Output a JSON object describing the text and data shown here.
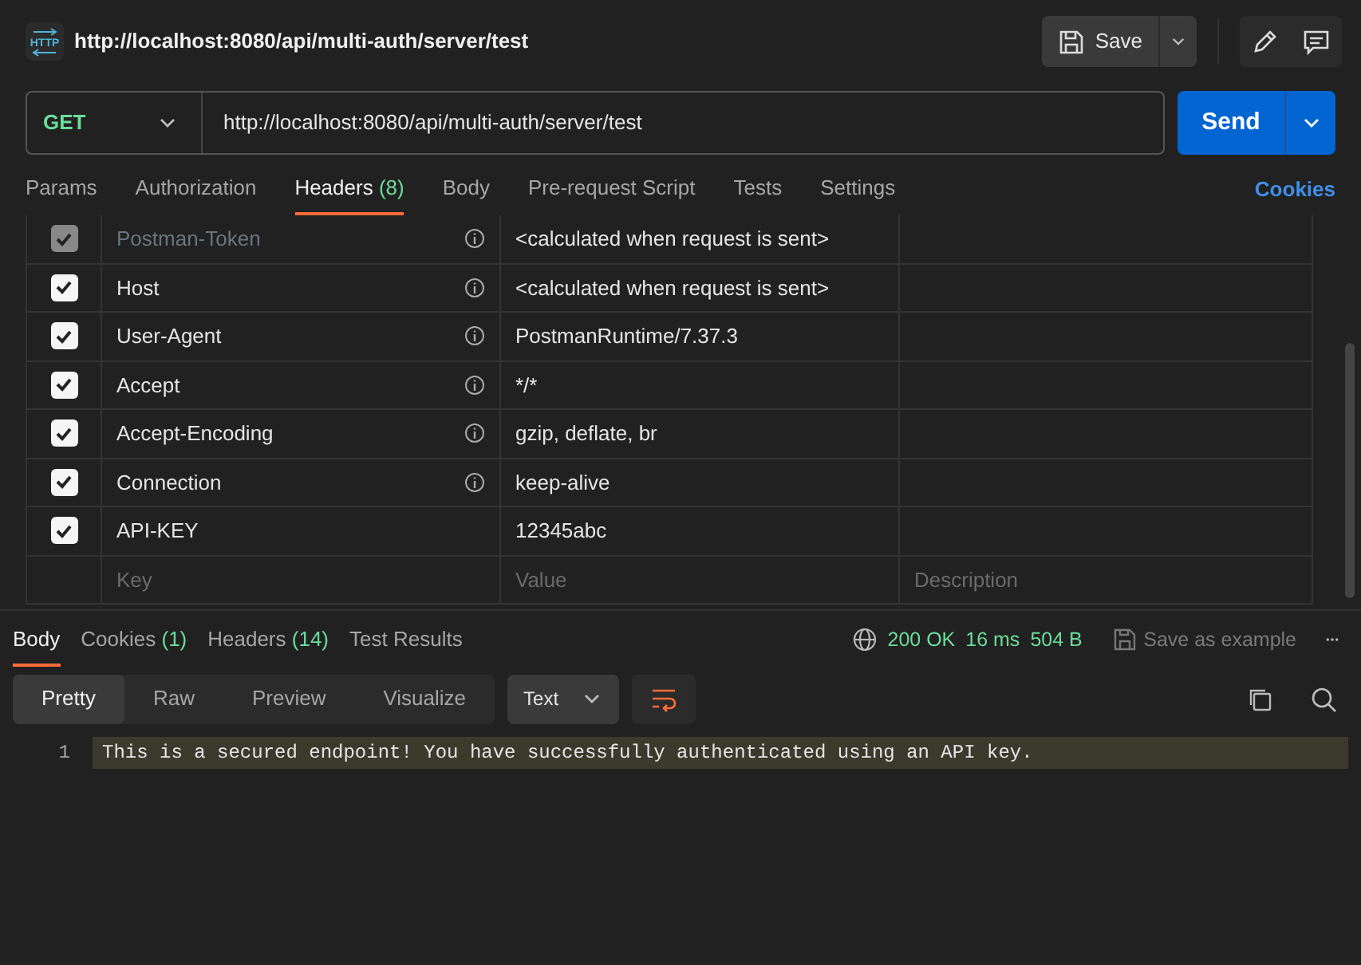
{
  "request_icon_label": "HTTP",
  "request_title": "http://localhost:8080/api/multi-auth/server/test",
  "save_button": "Save",
  "method": "GET",
  "url": "http://localhost:8080/api/multi-auth/server/test",
  "send_button": "Send",
  "request_tabs": [
    {
      "label": "Params",
      "selected": false
    },
    {
      "label": "Authorization",
      "selected": false
    },
    {
      "label": "Headers",
      "count": "(8)",
      "selected": true
    },
    {
      "label": "Body",
      "selected": false
    },
    {
      "label": "Pre-request Script",
      "selected": false
    },
    {
      "label": "Tests",
      "selected": false
    },
    {
      "label": "Settings",
      "selected": false
    }
  ],
  "cookies_link": "Cookies",
  "headers": [
    {
      "key": "Postman-Token",
      "value": "<calculated when request is sent>",
      "checked": true,
      "disabled": true,
      "info": true
    },
    {
      "key": "Host",
      "value": "<calculated when request is sent>",
      "checked": true,
      "disabled": false,
      "info": true
    },
    {
      "key": "User-Agent",
      "value": "PostmanRuntime/7.37.3",
      "checked": true,
      "disabled": false,
      "info": true
    },
    {
      "key": "Accept",
      "value": "*/*",
      "checked": true,
      "disabled": false,
      "info": true
    },
    {
      "key": "Accept-Encoding",
      "value": "gzip, deflate, br",
      "checked": true,
      "disabled": false,
      "info": true
    },
    {
      "key": "Connection",
      "value": "keep-alive",
      "checked": true,
      "disabled": false,
      "info": true
    },
    {
      "key": "API-KEY",
      "value": "12345abc",
      "checked": true,
      "disabled": false,
      "info": false
    }
  ],
  "new_header": {
    "key_placeholder": "Key",
    "value_placeholder": "Value",
    "description_placeholder": "Description"
  },
  "response_tabs": [
    {
      "label": "Body",
      "selected": true
    },
    {
      "label": "Cookies",
      "count": "(1)",
      "selected": false
    },
    {
      "label": "Headers",
      "count": "(14)",
      "selected": false
    },
    {
      "label": "Test Results",
      "selected": false
    }
  ],
  "status": {
    "code": "200 OK",
    "time": "16 ms",
    "size": "504 B"
  },
  "save_example": "Save as example",
  "view_modes": [
    {
      "label": "Pretty",
      "selected": true
    },
    {
      "label": "Raw",
      "selected": false
    },
    {
      "label": "Preview",
      "selected": false
    },
    {
      "label": "Visualize",
      "selected": false
    }
  ],
  "format": "Text",
  "code_lines": [
    {
      "number": "1",
      "text": "This is a secured endpoint! You have successfully authenticated using an API key."
    }
  ]
}
